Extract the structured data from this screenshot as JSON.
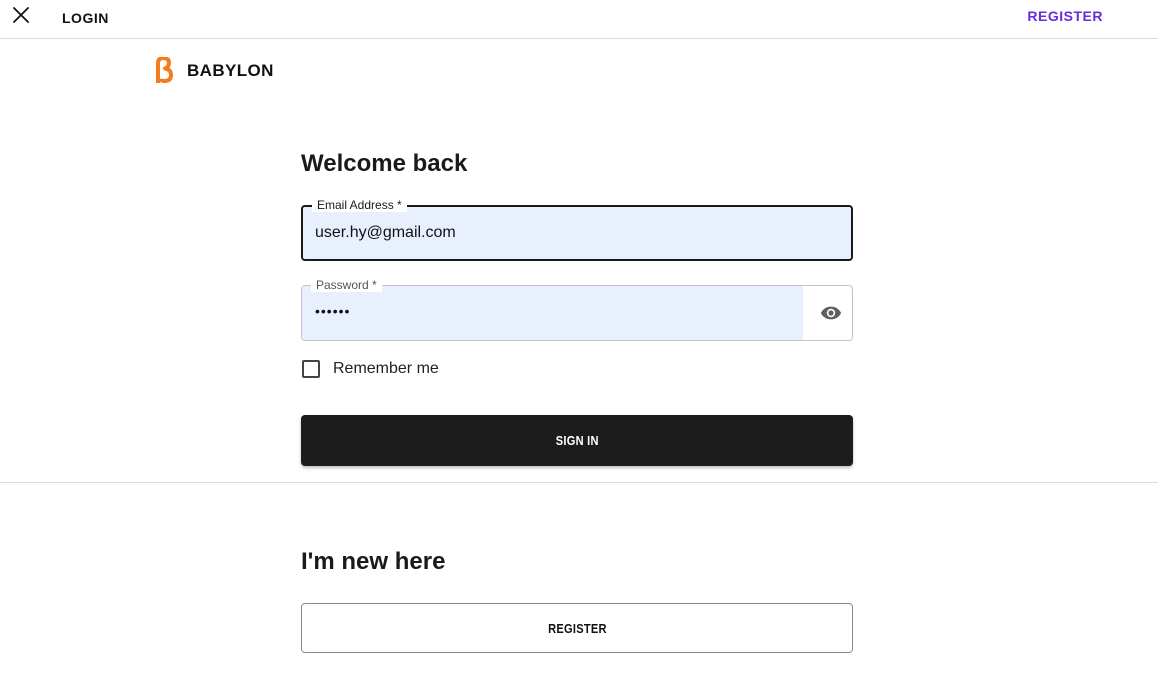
{
  "topbar": {
    "title": "LOGIN",
    "register_link": "REGISTER",
    "close_icon": "close-icon"
  },
  "brand": {
    "logo_icon": "beta-logo-icon",
    "name": "BABYLON",
    "color": "#f47b20"
  },
  "login": {
    "heading": "Welcome back",
    "email": {
      "label": "Email Address",
      "required_mark": "*",
      "value": "user.hy@gmail.com"
    },
    "password": {
      "label": "Password",
      "required_mark": "*",
      "value": "••••••",
      "toggle_icon": "eye-icon"
    },
    "remember_label": "Remember me",
    "remember_checked": false,
    "signin_label": "SIGN IN"
  },
  "register_section": {
    "heading": "I'm new here",
    "button_label": "REGISTER"
  },
  "colors": {
    "accent": "#6a2bd9",
    "autofill": "#e8f0fe",
    "primary_button": "#1c1c1c"
  }
}
